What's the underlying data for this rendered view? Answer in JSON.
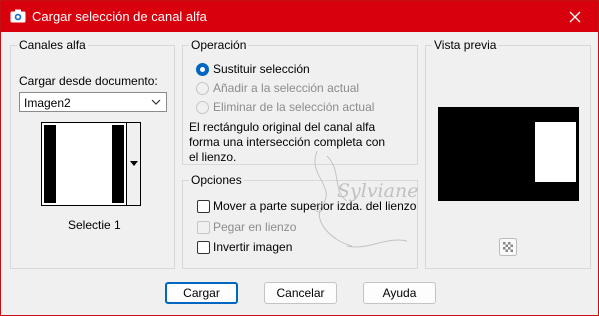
{
  "window": {
    "title": "Cargar selección de canal alfa",
    "accent": "#d9000d",
    "title_icon": "camera-icon",
    "close_icon": "close-icon"
  },
  "canales": {
    "group_title": "Canales alfa",
    "load_from_label": "Cargar desde documento:",
    "document_selected": "Imagen2",
    "channel_name": "Selectie 1"
  },
  "operacion": {
    "group_title": "Operación",
    "options": [
      {
        "label": "Sustituir selección",
        "checked": true,
        "enabled": true
      },
      {
        "label": "Añadir a la selección actual",
        "checked": false,
        "enabled": false
      },
      {
        "label": "Eliminar de la selección actual",
        "checked": false,
        "enabled": false
      }
    ],
    "description": "El rectángulo original del canal alfa forma una intersección completa con el lienzo."
  },
  "opciones": {
    "group_title": "Opciones",
    "checks": [
      {
        "label": "Mover a parte superior izda. del lienzo",
        "checked": false,
        "enabled": true
      },
      {
        "label": "Pegar en lienzo",
        "checked": false,
        "enabled": false
      },
      {
        "label": "Invertir imagen",
        "checked": false,
        "enabled": true
      }
    ]
  },
  "vista_previa": {
    "group_title": "Vista previa",
    "zoom_icon": "checkerboard-icon"
  },
  "buttons": {
    "load": "Cargar",
    "cancel": "Cancelar",
    "help": "Ayuda"
  },
  "watermark": "Sylviane"
}
